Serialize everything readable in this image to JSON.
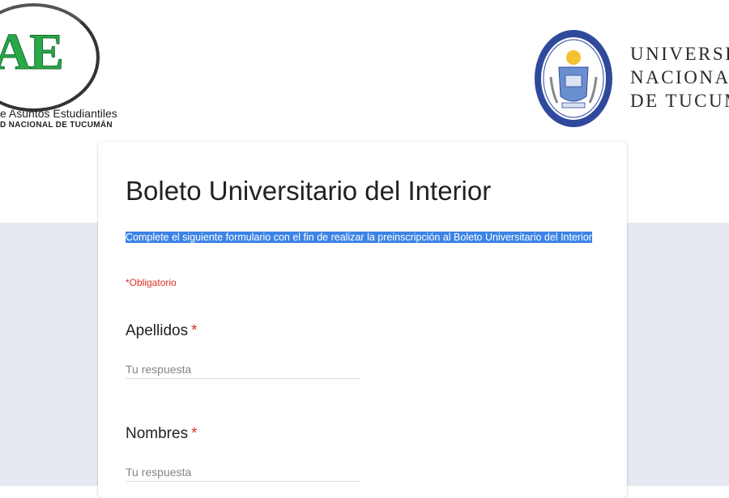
{
  "header": {
    "left_logo": {
      "mark": "AE",
      "line1": "e Asuntos Estudiantiles",
      "line2": "D NACIONAL DE TUCUMÁN"
    },
    "right_logo": {
      "lines": [
        "UNIVERSI",
        "NACIONA",
        "DE TUCUM"
      ]
    }
  },
  "form": {
    "title": "Boleto Universitario del Interior",
    "description": "Complete el siguiente formulario con el fin de realizar la preinscripción al Boleto Universitario del Interior",
    "required_note": "*Obligatorio",
    "questions": [
      {
        "label": "Apellidos",
        "required_mark": "*",
        "placeholder": "Tu respuesta"
      },
      {
        "label": "Nombres",
        "required_mark": "*",
        "placeholder": "Tu respuesta"
      }
    ]
  },
  "colors": {
    "page_bg_lower": "#e6e8f2",
    "selection": "#3b83e6",
    "required": "#d93025",
    "logo_green": "#2aa84a",
    "seal_blue": "#2f4a9c"
  }
}
